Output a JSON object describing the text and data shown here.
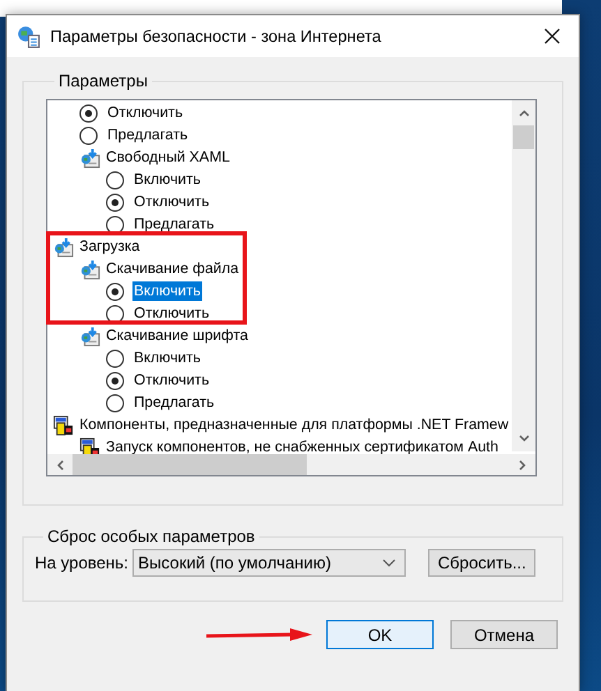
{
  "window": {
    "title": "Параметры безопасности - зона Интернета"
  },
  "settings_group": {
    "title": "Параметры",
    "tree": [
      {
        "kind": "continued",
        "children": [
          {
            "kind": "radio",
            "label": "Отключить",
            "checked": true,
            "selected": false
          },
          {
            "kind": "radio",
            "label": "Предлагать",
            "checked": false,
            "selected": false
          },
          {
            "kind": "setting",
            "label": "Свободный XAML",
            "children": [
              {
                "kind": "radio",
                "label": "Включить",
                "checked": false,
                "selected": false
              },
              {
                "kind": "radio",
                "label": "Отключить",
                "checked": true,
                "selected": false
              },
              {
                "kind": "radio",
                "label": "Предлагать",
                "checked": false,
                "selected": false
              }
            ]
          }
        ]
      },
      {
        "kind": "category",
        "label": "Загрузка",
        "children": [
          {
            "kind": "setting",
            "label": "Скачивание файла",
            "children": [
              {
                "kind": "radio",
                "label": "Включить",
                "checked": true,
                "selected": true
              },
              {
                "kind": "radio",
                "label": "Отключить",
                "checked": false,
                "selected": false
              }
            ]
          },
          {
            "kind": "setting",
            "label": "Скачивание шрифта",
            "children": [
              {
                "kind": "radio",
                "label": "Включить",
                "checked": false,
                "selected": false
              },
              {
                "kind": "radio",
                "label": "Отключить",
                "checked": true,
                "selected": false
              },
              {
                "kind": "radio",
                "label": "Предлагать",
                "checked": false,
                "selected": false
              }
            ]
          }
        ]
      },
      {
        "kind": "component",
        "label": "Компоненты, предназначенные для платформы .NET Framew",
        "children": [
          {
            "kind": "component",
            "label": "Запуск компонентов, не снабженных сертификатом Auth"
          }
        ]
      }
    ]
  },
  "reset_group": {
    "title": "Сброс особых параметров",
    "level_label": "На уровень:",
    "level_value": "Высокий (по умолчанию)",
    "reset_button": "Сбросить..."
  },
  "buttons": [
    {
      "label": "OK",
      "default": true
    },
    {
      "label": "Отмена",
      "default": false
    }
  ]
}
